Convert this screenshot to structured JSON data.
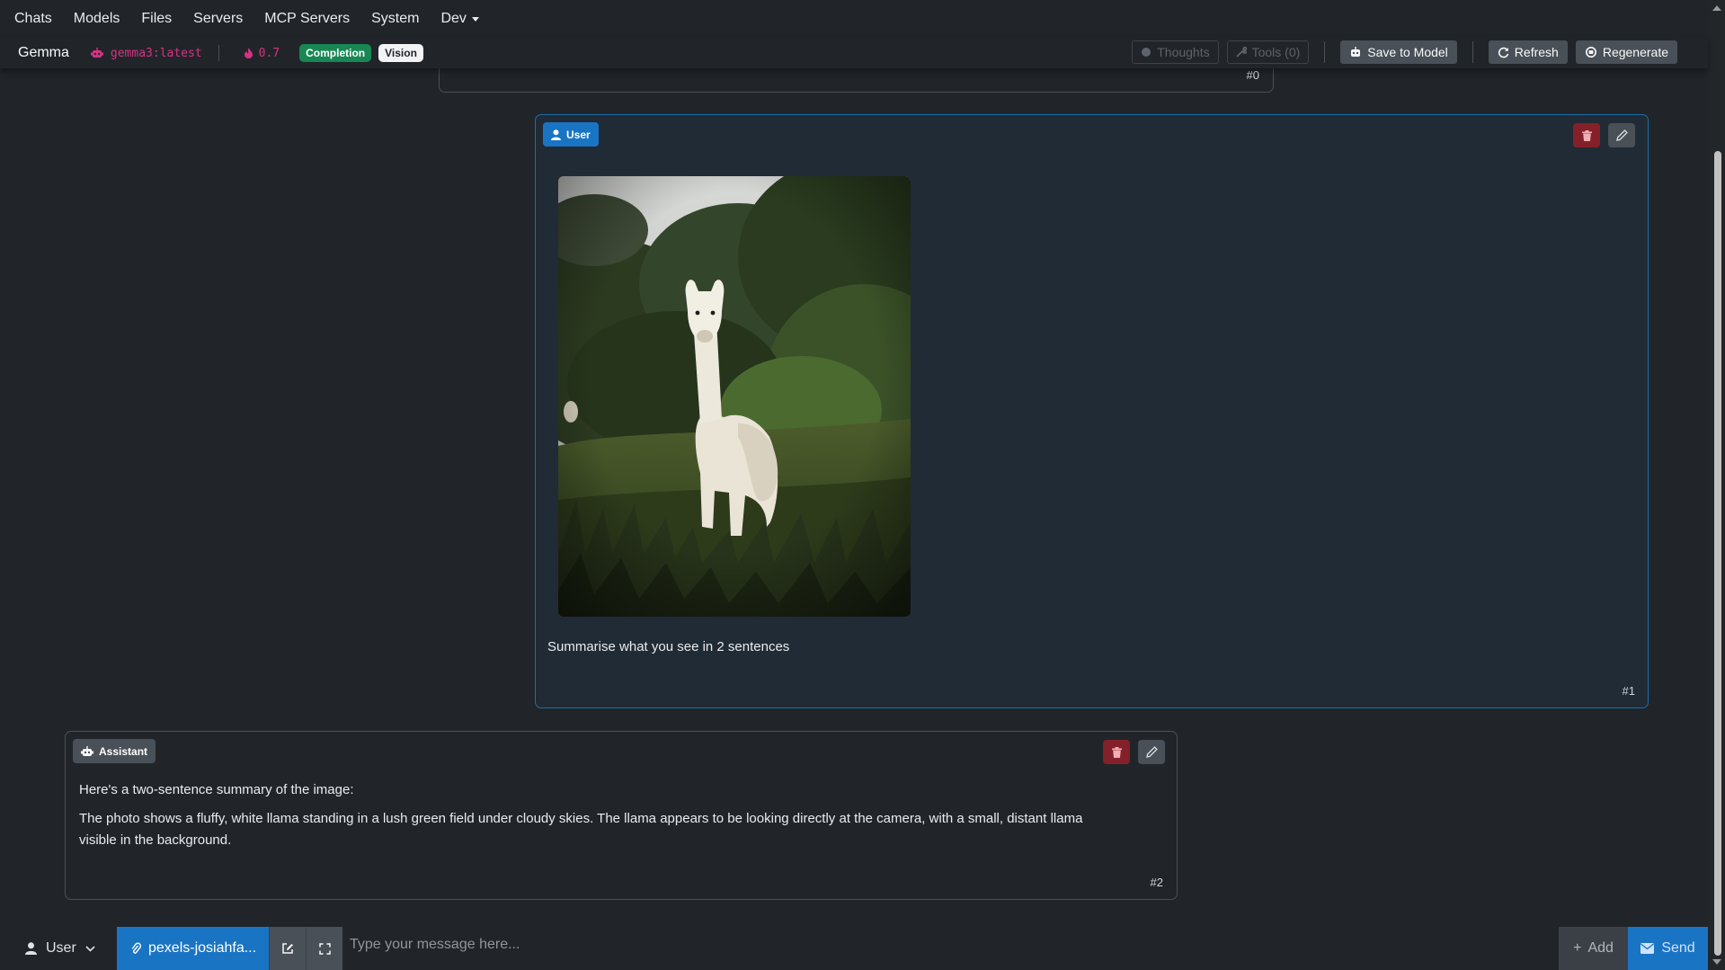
{
  "nav": {
    "items": [
      "Chats",
      "Models",
      "Files",
      "Servers",
      "MCP Servers",
      "System"
    ],
    "dev_label": "Dev"
  },
  "chat_header": {
    "title": "Gemma",
    "model": "gemma3:latest",
    "temperature": "0.7",
    "badges": [
      "Completion",
      "Vision"
    ],
    "thoughts_label": "Thoughts",
    "tools_label": "Tools (0)",
    "save_label": "Save to Model",
    "refresh_label": "Refresh",
    "regenerate_label": "Regenerate"
  },
  "messages": {
    "previous": {
      "number": "#0"
    },
    "user": {
      "role": "User",
      "number": "#1",
      "image_desc": "llama photo",
      "text": "Summarise what you see in 2 sentences"
    },
    "assistant": {
      "role": "Assistant",
      "number": "#2",
      "line1": "Here's a two-sentence summary of the image:",
      "line2": "The photo shows a fluffy, white llama standing in a lush green field under cloudy skies. The llama appears to be looking directly at the camera, with a small, distant llama",
      "line3": "visible in the background."
    }
  },
  "composer": {
    "role": "User",
    "attachment": "pexels-josiahfa...",
    "placeholder": "Type your message here...",
    "add_label": "Add",
    "send_label": "Send"
  },
  "colors": {
    "background": "#212529",
    "accent_blue": "#1a74c4",
    "model_pink": "#d63384",
    "badge_green": "#198754",
    "delete_red": "#842029"
  }
}
